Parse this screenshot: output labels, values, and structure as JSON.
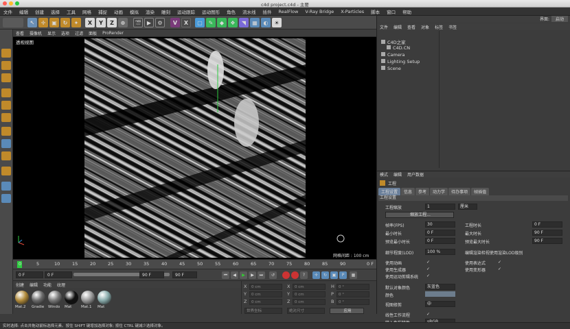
{
  "window": {
    "title": "c4d project.c4d - 主要"
  },
  "menubar": [
    "文件",
    "编辑",
    "创建",
    "选择",
    "工具",
    "网格",
    "捕捉",
    "动画",
    "模拟",
    "渲染",
    "雕刻",
    "运动跟踪",
    "运动图形",
    "角色",
    "流水线",
    "插件",
    "RealFlow",
    "V-Ray Bridge",
    "X-Particles",
    "脚本",
    "窗口",
    "帮助"
  ],
  "interface": {
    "label": "界面:",
    "value": "启动"
  },
  "viewport": {
    "menu": [
      "查看",
      "摄像机",
      "显示",
      "选项",
      "过滤",
      "面板",
      "ProRender"
    ],
    "label": "透视视图",
    "grid_spacing": "网格间距 : 100 cm"
  },
  "timeline": {
    "ticks": [
      "0",
      "5",
      "10",
      "15",
      "20",
      "25",
      "30",
      "35",
      "40",
      "45",
      "50",
      "55",
      "60",
      "65",
      "70",
      "75",
      "80",
      "85",
      "90"
    ],
    "end": "0 F"
  },
  "transport": {
    "start": "0 F",
    "current": "0 F",
    "end_a": "90 F",
    "end_b": "90 F"
  },
  "materials": {
    "menu": [
      "创建",
      "编辑",
      "功能",
      "纹理"
    ],
    "items": [
      {
        "label": "Mat.2",
        "color": "#b08a3a"
      },
      {
        "label": "Gradie",
        "color": "#6a6a6a"
      },
      {
        "label": "Windo",
        "color": "#777"
      },
      {
        "label": "Mat",
        "color": "#111"
      },
      {
        "label": "Mat.1",
        "color": "#999"
      },
      {
        "label": "Mat",
        "color": "#8aa"
      }
    ]
  },
  "coords": {
    "rows": [
      {
        "axis": "X",
        "v1": "0 cm",
        "a2": "X",
        "v2": "0 cm",
        "a3": "H",
        "v3": "0 °"
      },
      {
        "axis": "Y",
        "v1": "0 cm",
        "a2": "Y",
        "v2": "0 cm",
        "a3": "P",
        "v3": "0 °"
      },
      {
        "axis": "Z",
        "v1": "0 cm",
        "a2": "Z",
        "v2": "0 cm",
        "a3": "B",
        "v3": "0 °"
      }
    ],
    "mode": "世界坐标",
    "scale": "绝对尺寸",
    "apply": "应用"
  },
  "right": {
    "top_menu": [
      "文件",
      "编辑",
      "查看",
      "对象",
      "标签",
      "书签"
    ],
    "objects": [
      "C4D之家",
      "C4D.CN",
      "Camera",
      "Lighting Setup",
      "Scene"
    ]
  },
  "attributes": {
    "menu": [
      "模式",
      "编辑",
      "用户数据"
    ],
    "title": "工程",
    "tabs": [
      "工程设置",
      "信息",
      "参考",
      "动力学",
      "待办事项",
      "帧插值"
    ],
    "section": "工程设置",
    "scale_label": "工程缩放",
    "scale_value": "1",
    "scale_unit": "厘米",
    "scale_btn": "缩放工程...",
    "fps_label": "帧率(FPS)",
    "fps": "30",
    "ptime_label": "工程时长",
    "ptime": "0 F",
    "min_label": "最小时长",
    "min": "0 F",
    "max_label": "最大时长",
    "max": "90 F",
    "pmin_label": "预览最小时长",
    "pmin": "0 F",
    "pmax_label": "预览最大时长",
    "pmax": "90 F",
    "lod_label": "细节程度(LOD)",
    "lod": "100 %",
    "lod_check": "编辑渲染检视使用渲染LOD级别",
    "checks_left": [
      "使用动画",
      "使用生成器",
      "使用运动剪辑系统"
    ],
    "checks_right": [
      "使用表达式",
      "使用变形器"
    ],
    "color_label": "默认对象颜色",
    "color_value": "灰蓝色",
    "color2_label": "颜色",
    "view_label": "视图修剪",
    "view_value": "中",
    "linear_label": "线性工作流程",
    "input_label": "输入色彩特性",
    "input_value": "sRGB"
  },
  "statusbar": "实时选择: 点击并拖动鼠标选择元素。按住 SHIFT 键增加选择对象; 按住 CTRL 键减少选择对象。"
}
